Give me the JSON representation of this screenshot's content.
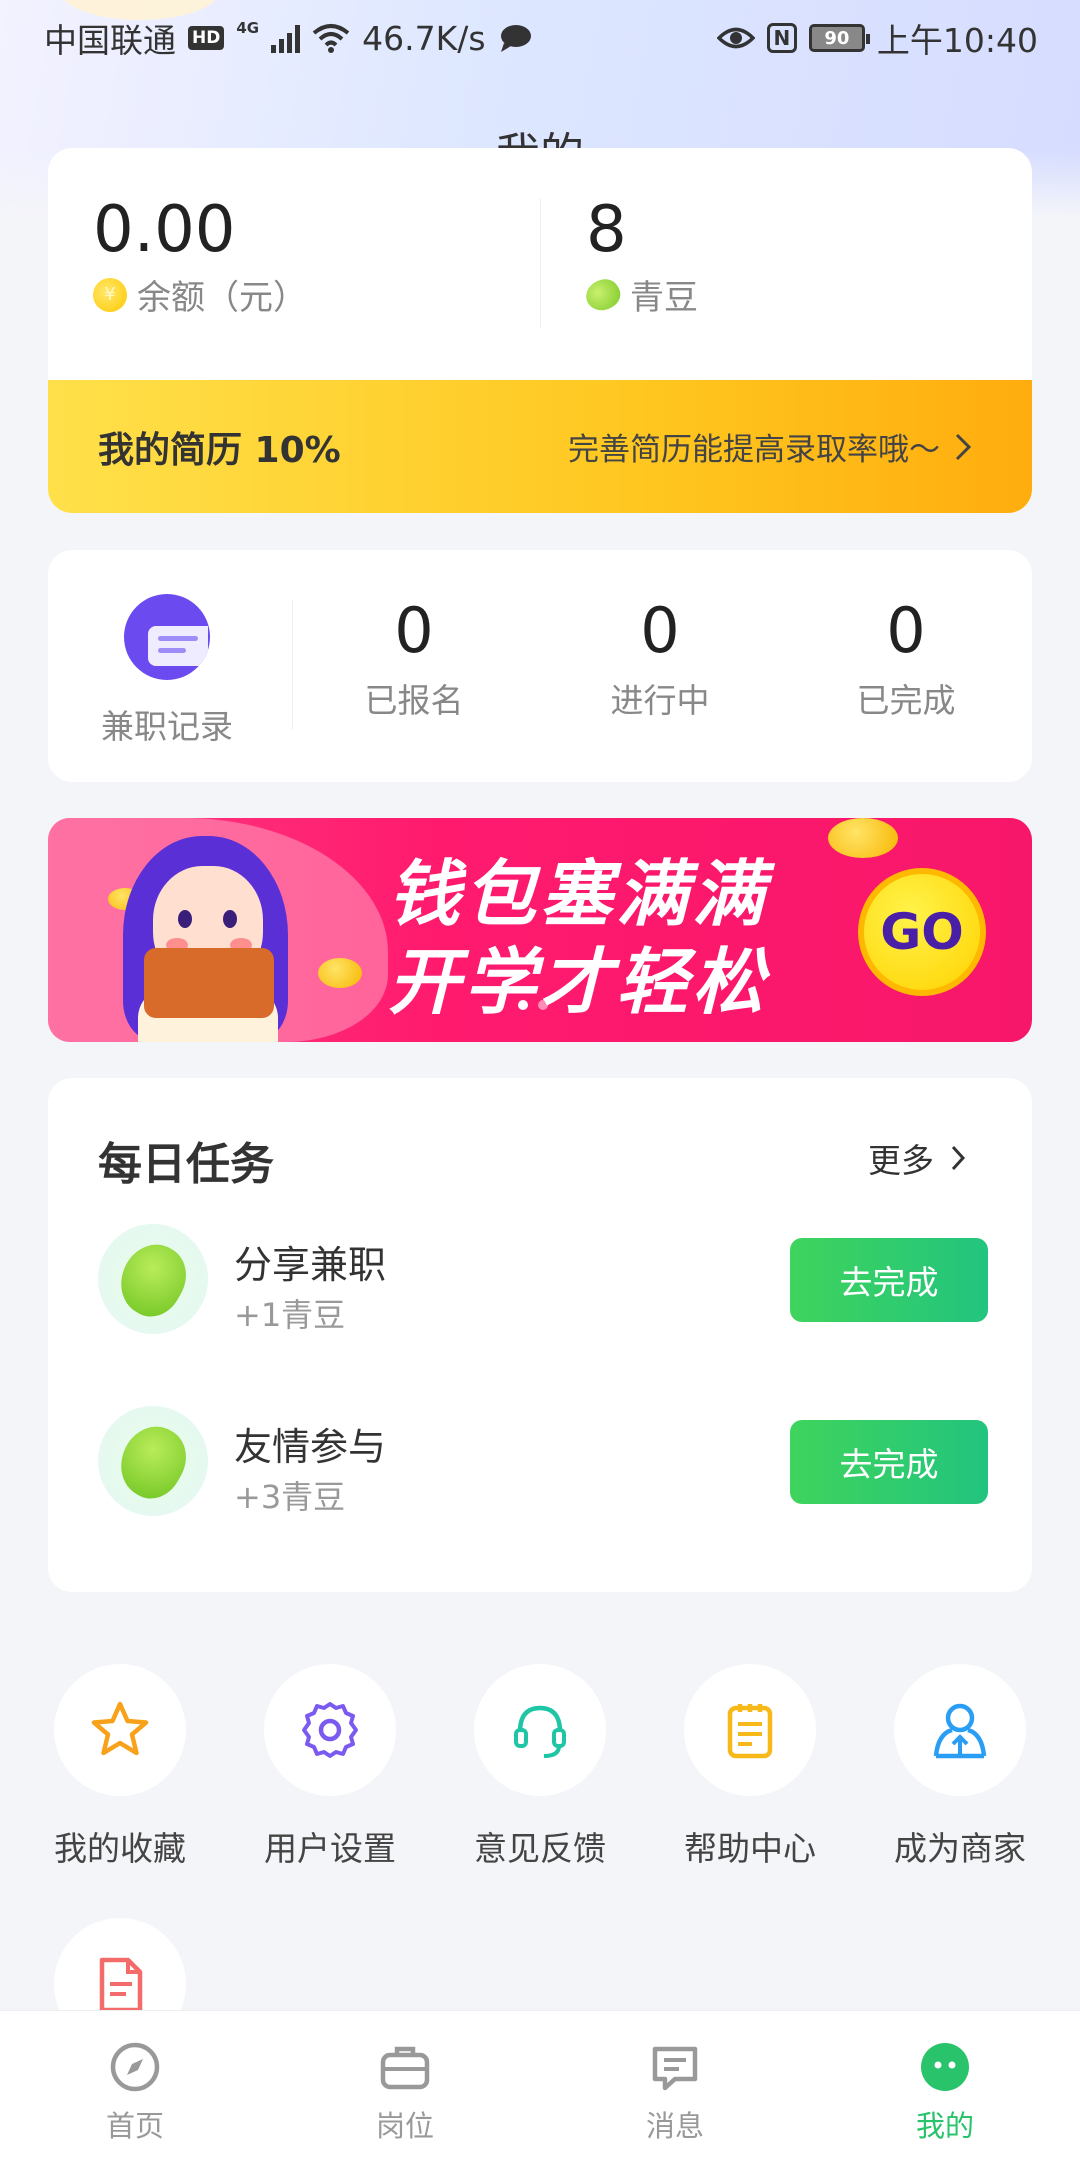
{
  "status_bar": {
    "carrier": "中国联通",
    "hd": "HD",
    "network": "4G",
    "speed": "46.7K/s",
    "nfc": "N",
    "battery": "90",
    "time": "上午10:40"
  },
  "page_title": "我的",
  "wallet": {
    "balance_value": "0.00",
    "balance_label": "余额（元）",
    "beans_value": "8",
    "beans_label": "青豆"
  },
  "resume": {
    "title": "我的简历 10%",
    "tip": "完善简历能提高录取率哦～",
    "progress_percent": 10
  },
  "records": {
    "entry_label": "兼职记录",
    "stats": [
      {
        "value": "0",
        "label": "已报名"
      },
      {
        "value": "0",
        "label": "进行中"
      },
      {
        "value": "0",
        "label": "已完成"
      }
    ]
  },
  "banner": {
    "slogan_line1": "钱包塞满满",
    "slogan_line2": "开学才轻松",
    "go_label": "GO"
  },
  "daily_tasks": {
    "title": "每日任务",
    "more_label": "更多",
    "tasks": [
      {
        "name": "分享兼职",
        "reward": "+1青豆",
        "button": "去完成"
      },
      {
        "name": "友情参与",
        "reward": "+3青豆",
        "button": "去完成"
      }
    ]
  },
  "services": [
    {
      "label": "我的收藏",
      "icon": "star-icon",
      "color": "#f7a21a"
    },
    {
      "label": "用户设置",
      "icon": "gear-icon",
      "color": "#7a5af0"
    },
    {
      "label": "意见反馈",
      "icon": "headset-icon",
      "color": "#1fc6a6"
    },
    {
      "label": "帮助中心",
      "icon": "notepad-icon",
      "color": "#f7b81a"
    },
    {
      "label": "成为商家",
      "icon": "merchant-icon",
      "color": "#2a9df4"
    },
    {
      "label": "",
      "icon": "document-icon",
      "color": "#f36b6b"
    }
  ],
  "bottom_nav": {
    "items": [
      {
        "label": "首页",
        "icon": "compass-icon",
        "active": false
      },
      {
        "label": "岗位",
        "icon": "briefcase-icon",
        "active": false
      },
      {
        "label": "消息",
        "icon": "message-icon",
        "active": false
      },
      {
        "label": "我的",
        "icon": "profile-icon",
        "active": true
      }
    ],
    "active_color": "#28c36a",
    "inactive_color": "#999999"
  }
}
